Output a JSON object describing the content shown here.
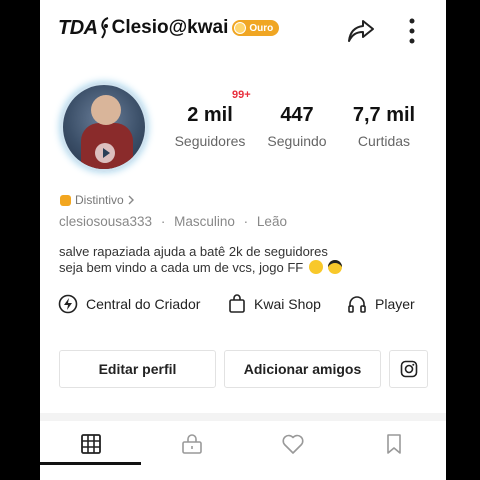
{
  "header": {
    "title_prefix": "TDA",
    "username": "Clesio@kwai",
    "badge_label": "Ouro"
  },
  "stats": {
    "notification_badge": "99+",
    "followers": {
      "value": "2 mil",
      "label": "Seguidores"
    },
    "following": {
      "value": "447",
      "label": "Seguindo"
    },
    "likes": {
      "value": "7,7 mil",
      "label": "Curtidas"
    }
  },
  "profile": {
    "distintivo_label": "Distintivo",
    "handle": "clesiosousa333",
    "separator": "·",
    "gender": "Masculino",
    "sign": "Leão",
    "bio_line1": "salve rapaziada ajuda a batê 2k de seguidores",
    "bio_line2": "seja bem vindo a cada um de vcs, jogo FF"
  },
  "shortcuts": {
    "creator": "Central do Criador",
    "shop": "Kwai Shop",
    "player": "Player"
  },
  "actions": {
    "edit_profile": "Editar perfil",
    "add_friends": "Adicionar amigos"
  },
  "tabs": [
    {
      "icon": "grid-icon",
      "active": true
    },
    {
      "icon": "lock-icon",
      "active": false
    },
    {
      "icon": "heart-icon",
      "active": false
    },
    {
      "icon": "bookmark-icon",
      "active": false
    }
  ],
  "colors": {
    "gold_badge": "#f0a623",
    "notification_red": "#e8303e",
    "text_primary": "#222222",
    "text_secondary": "#888888"
  }
}
